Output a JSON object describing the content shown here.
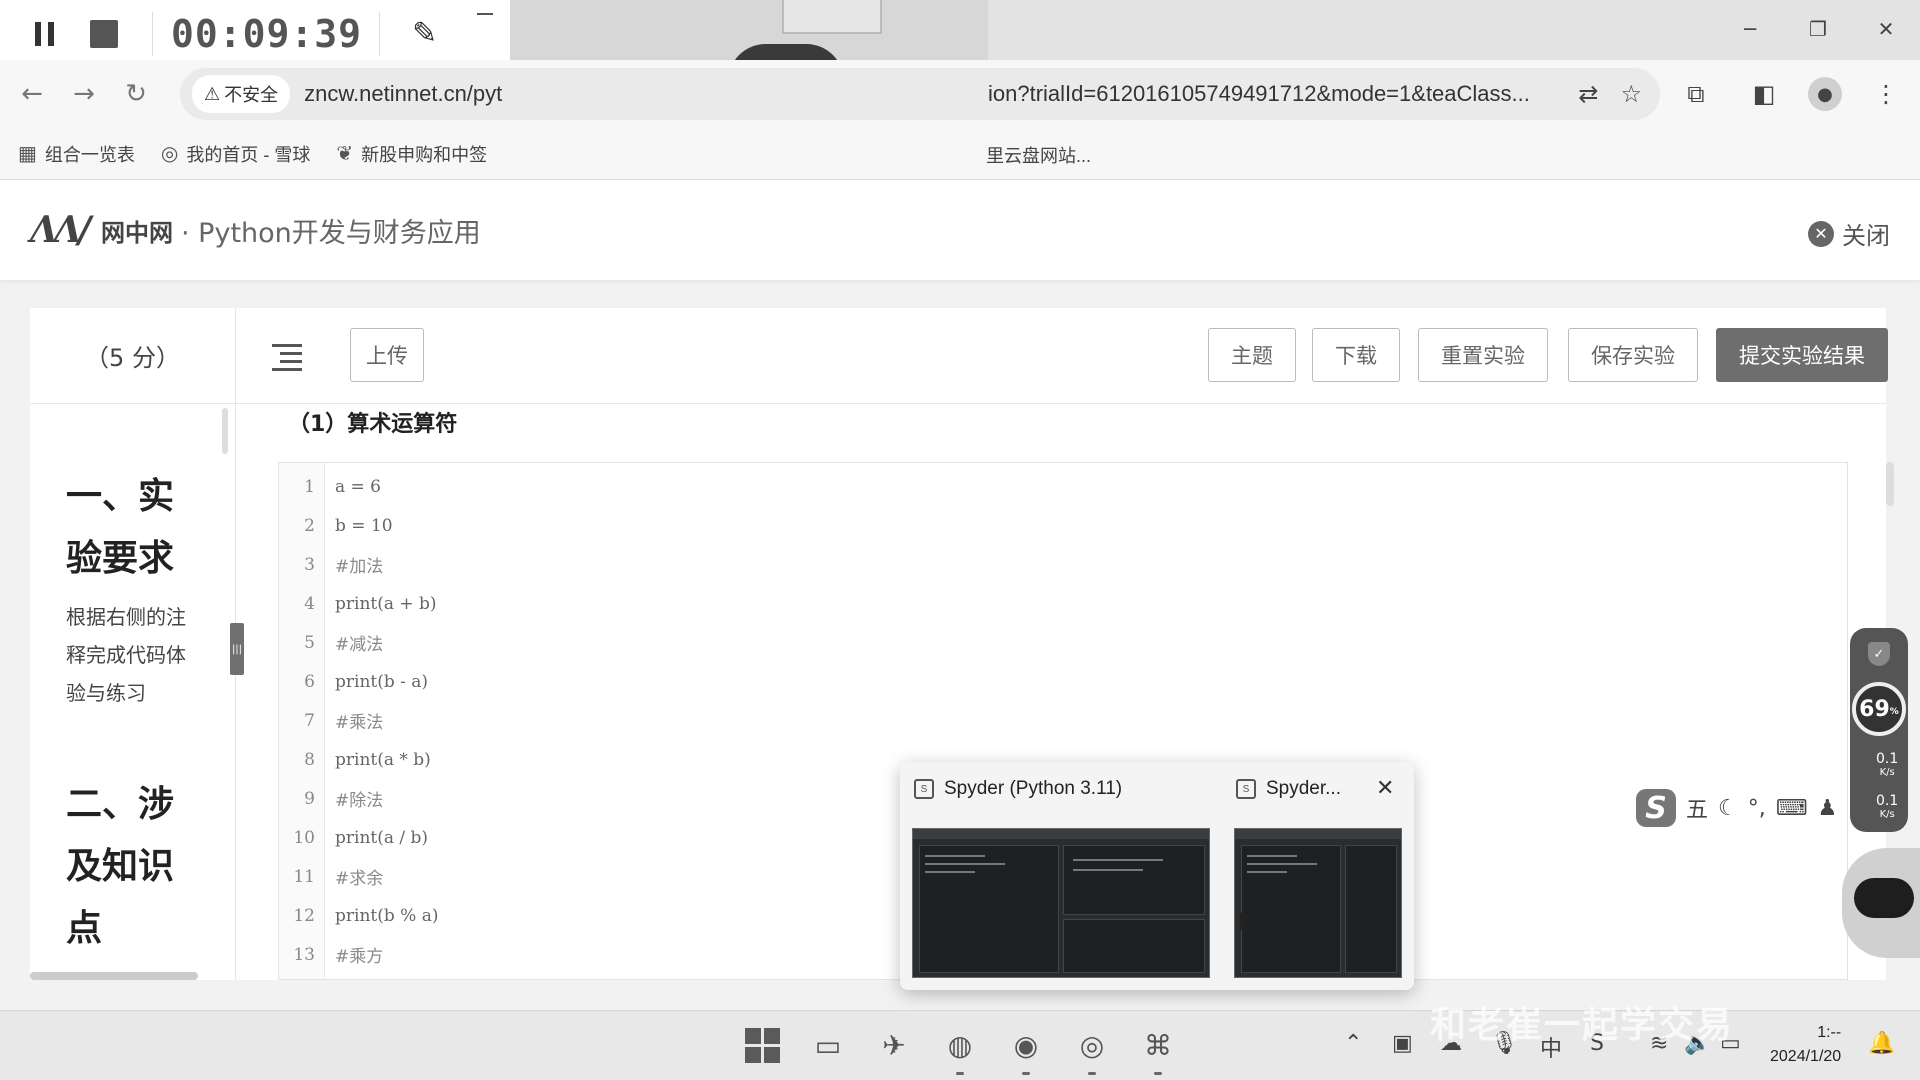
{
  "recorder": {
    "time": "00:09:39"
  },
  "window": {
    "minimize": "─",
    "restore": "❐",
    "close": "✕"
  },
  "browser": {
    "back": "←",
    "forward": "→",
    "reload": "↻",
    "security_label": "不安全",
    "url_left": "zncw.netinnet.cn/pyt",
    "url_right": "ion?trialId=612016105749491712&mode=1&teaClass...",
    "bookmarks": [
      {
        "label": "组合一览表"
      },
      {
        "label": "我的首页 - 雪球"
      },
      {
        "label": "新股申购和中签"
      }
    ],
    "bookmark_right": "里云盘网站..."
  },
  "site": {
    "logo_text": "网中网",
    "course_title": "· Python开发与财务应用",
    "close_label": "关闭"
  },
  "panel": {
    "score": "（5 分）",
    "buttons": {
      "upload": "上传",
      "theme": "主题",
      "download": "下载",
      "reset": "重置实验",
      "save": "保存实验",
      "submit": "提交实验结果"
    },
    "requirements": {
      "heading1_line1": "一、实",
      "heading1_line2": "验要求",
      "text": "根据右侧的注释完成代码体验与练习",
      "heading2_line1": "二、涉",
      "heading2_line2": "及知识",
      "heading2_line3": "点"
    },
    "section_title": "（1）算术运算符"
  },
  "code_lines": [
    {
      "n": "1",
      "text": "a = 6"
    },
    {
      "n": "2",
      "text": "b = 10"
    },
    {
      "n": "3",
      "text": "#加法"
    },
    {
      "n": "4",
      "text": "print(a + b)"
    },
    {
      "n": "5",
      "text": "#减法"
    },
    {
      "n": "6",
      "text": "print(b - a)"
    },
    {
      "n": "7",
      "text": "#乘法"
    },
    {
      "n": "8",
      "text": "print(a * b)"
    },
    {
      "n": "9",
      "text": "#除法"
    },
    {
      "n": "10",
      "text": "print(a / b)"
    },
    {
      "n": "11",
      "text": "#求余"
    },
    {
      "n": "12",
      "text": "print(b % a)"
    },
    {
      "n": "13",
      "text": "#乘方"
    }
  ],
  "thumbs": {
    "first": "Spyder (Python 3.11)",
    "second": "Spyder...",
    "close": "✕"
  },
  "widget": {
    "percent": "69",
    "unit": "%",
    "up": "0.1",
    "down": "0.1",
    "rate_unit": "K/s"
  },
  "ime": {
    "logo": "S",
    "mode": "五"
  },
  "taskbar": {
    "time": "1:--",
    "date": "2024/1/20"
  },
  "watermark": "和老崔一起学交易"
}
